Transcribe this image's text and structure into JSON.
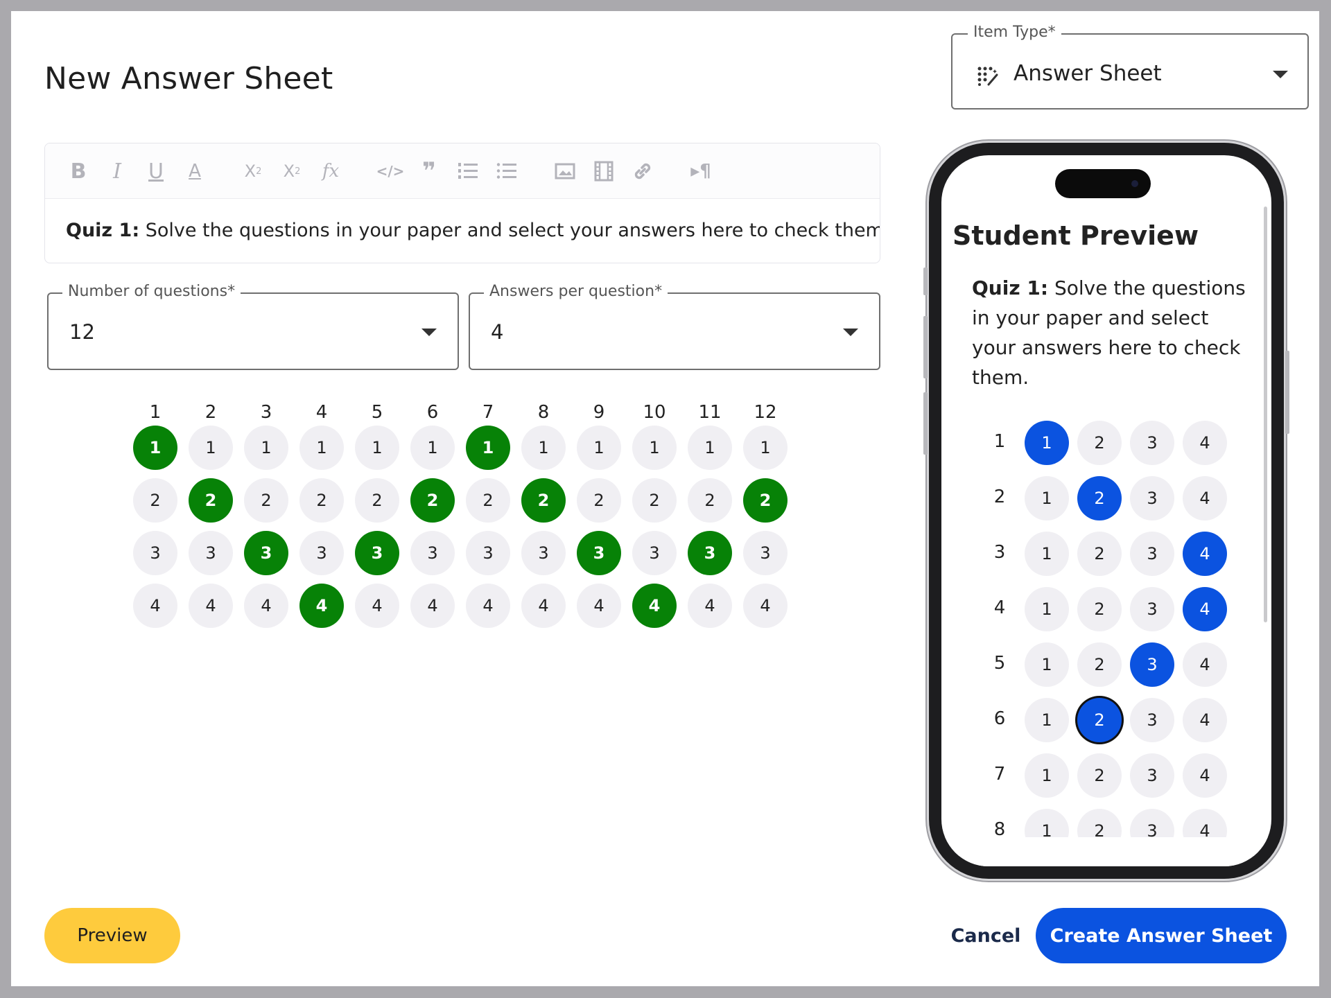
{
  "title": "New Answer Sheet",
  "item_type": {
    "label": "Item Type*",
    "value": "Answer Sheet",
    "icon": "dots-magic-icon"
  },
  "toolbar": {
    "buttons": [
      {
        "name": "bold-icon",
        "glyph": "B"
      },
      {
        "name": "italic-icon",
        "glyph": "I"
      },
      {
        "name": "underline-icon",
        "glyph": "U"
      },
      {
        "name": "text-color-icon",
        "glyph": "A"
      },
      {
        "name": "subscript-icon",
        "glyph": "X₂"
      },
      {
        "name": "superscript-icon",
        "glyph": "X²"
      },
      {
        "name": "formula-icon",
        "glyph": "fx"
      },
      {
        "name": "code-icon",
        "glyph": "</>"
      },
      {
        "name": "quote-icon",
        "glyph": "❞"
      },
      {
        "name": "ordered-list-icon",
        "glyph": "≡"
      },
      {
        "name": "bullet-list-icon",
        "glyph": "☰"
      },
      {
        "name": "image-icon",
        "glyph": "▣"
      },
      {
        "name": "video-icon",
        "glyph": "▥"
      },
      {
        "name": "link-icon",
        "glyph": "∞"
      },
      {
        "name": "text-direction-icon",
        "glyph": "¶"
      }
    ]
  },
  "editor": {
    "bold_prefix": "Quiz 1:",
    "text": " Solve the questions in your paper and select your answers here to check them."
  },
  "num_questions": {
    "label": "Number of questions*",
    "value": "12"
  },
  "answers_per_question": {
    "label": "Answers per question*",
    "value": "4"
  },
  "answer_grid": {
    "questions": [
      "1",
      "2",
      "3",
      "4",
      "5",
      "6",
      "7",
      "8",
      "9",
      "10",
      "11",
      "12"
    ],
    "options": [
      "1",
      "2",
      "3",
      "4"
    ],
    "correct": [
      1,
      2,
      3,
      4,
      3,
      2,
      1,
      2,
      3,
      4,
      3,
      2
    ],
    "selected_color": "#078207"
  },
  "student_preview": {
    "title": "Student Preview",
    "bold_prefix": "Quiz 1:",
    "text": " Solve the questions in your paper and select your answers here to check them.",
    "rows": [
      "1",
      "2",
      "3",
      "4",
      "5",
      "6",
      "7",
      "8"
    ],
    "options": [
      "1",
      "2",
      "3",
      "4"
    ],
    "selected": [
      1,
      2,
      4,
      4,
      3,
      2,
      0,
      0
    ],
    "focused_row": 6,
    "selected_color": "#0b53e0"
  },
  "buttons": {
    "preview": "Preview",
    "cancel": "Cancel",
    "create": "Create Answer Sheet"
  },
  "colors": {
    "accent_blue": "#0b53e0",
    "accent_green": "#078207",
    "preview_yellow": "#fecb3d"
  }
}
